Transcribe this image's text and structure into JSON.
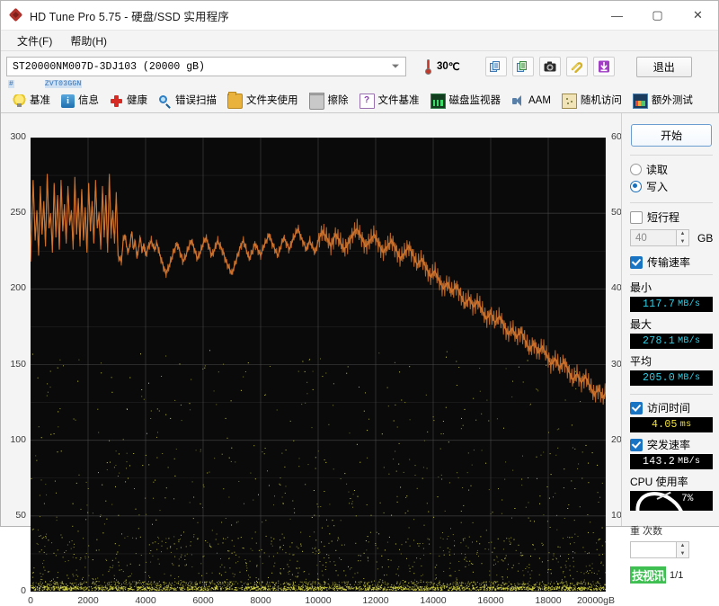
{
  "window": {
    "title": "HD Tune Pro 5.75 - 硬盘/SSD 实用程序",
    "app_icon": "diamond-logo-icon",
    "minimize": "—",
    "maximize": "▢",
    "close": "✕"
  },
  "menu": {
    "items": [
      {
        "label": "文件(F)",
        "name": "menu-file"
      },
      {
        "label": "帮助(H)",
        "name": "menu-help"
      }
    ]
  },
  "drive": {
    "selected": "ST20000NM007D-3DJ103  (20000  gB)",
    "serial_hash": "#",
    "serial": "ZVT03GGN"
  },
  "toolbar": {
    "temperature": "30",
    "temperature_unit": "℃",
    "thermometer_icon": "thermometer-icon",
    "buttons": [
      {
        "name": "copy-button",
        "icon": "copy-icon"
      },
      {
        "name": "copy-alt-button",
        "icon": "copy-green-icon"
      },
      {
        "name": "screenshot-button",
        "icon": "camera-icon"
      },
      {
        "name": "attach-button",
        "icon": "paperclip-icon"
      },
      {
        "name": "download-button",
        "icon": "download-arrow-icon"
      }
    ],
    "exit_label": "退出"
  },
  "tabs": [
    {
      "label": "基准",
      "icon": "bulb-icon",
      "name": "tab-benchmark",
      "active": true
    },
    {
      "label": "信息",
      "icon": "info-icon",
      "name": "tab-info",
      "active": false
    },
    {
      "label": "健康",
      "icon": "health-cross-icon",
      "name": "tab-health",
      "active": false
    },
    {
      "label": "错误扫描",
      "icon": "magnifier-icon",
      "name": "tab-error-scan",
      "active": false
    },
    {
      "label": "文件夹使用",
      "icon": "folder-icon",
      "name": "tab-folder-usage",
      "active": false
    },
    {
      "label": "擦除",
      "icon": "trash-icon",
      "name": "tab-erase",
      "active": false
    },
    {
      "label": "文件基准",
      "icon": "file-bench-icon",
      "name": "tab-file-benchmark",
      "active": false
    },
    {
      "label": "磁盘监视器",
      "icon": "monitor-icon",
      "name": "tab-disk-monitor",
      "active": false
    },
    {
      "label": "AAM",
      "icon": "speaker-icon",
      "name": "tab-aam",
      "active": false
    },
    {
      "label": "随机访问",
      "icon": "random-icon",
      "name": "tab-random-access",
      "active": false
    },
    {
      "label": "额外测试",
      "icon": "extra-icon",
      "name": "tab-extra-tests",
      "active": false
    }
  ],
  "panel": {
    "start_label": "开始",
    "mode": {
      "read_label": "读取",
      "write_label": "写入",
      "selected": "write"
    },
    "short_stroke": {
      "label": "短行程",
      "checked": false,
      "value": "40",
      "unit": "GB"
    },
    "transfer_rate": {
      "label": "传输速率",
      "checked": true,
      "min_label": "最小",
      "min_value": "117.7",
      "max_label": "最大",
      "max_value": "278.1",
      "avg_label": "平均",
      "avg_value": "205.0",
      "unit": "MB/s"
    },
    "access_time": {
      "label": "访问时间",
      "checked": true,
      "value": "4.05",
      "unit": "ms"
    },
    "burst_rate": {
      "label": "突发速率",
      "checked": true,
      "value": "143.2",
      "unit": "MB/s"
    },
    "cpu_usage": {
      "label": "CPU 使用率",
      "value": "7%"
    },
    "extra_label": "重  次数",
    "extra_value": "",
    "watermark_text": "技视讯",
    "page_indicator": "1/1"
  },
  "chart_data": {
    "type": "line",
    "title": "",
    "xlabel": "",
    "ylabel": "MB/s",
    "y2label": "ms",
    "xunit": "gB",
    "xlim": [
      0,
      20000
    ],
    "ylim": [
      0,
      300
    ],
    "y2lim": [
      0,
      60
    ],
    "yticks": [
      0,
      50,
      100,
      150,
      200,
      250,
      300
    ],
    "y2ticks": [
      10,
      20,
      30,
      40,
      50,
      60
    ],
    "xticks": [
      0,
      2000,
      4000,
      6000,
      8000,
      10000,
      12000,
      14000,
      16000,
      18000,
      20000
    ],
    "grid": true,
    "background": "#0a0a0a",
    "gridcolor": "#5a5a5a",
    "series": [
      {
        "name": "传输速率",
        "color": "#d4752e",
        "axis": "left",
        "unit": "MB/s",
        "x": [
          0,
          90,
          160,
          220,
          280,
          340,
          400,
          460,
          520,
          580,
          640,
          700,
          760,
          820,
          880,
          940,
          1000,
          1060,
          1120,
          1180,
          1240,
          1300,
          1360,
          1420,
          1480,
          1540,
          1600,
          1660,
          1720,
          1780,
          1840,
          1900,
          1960,
          2020,
          2080,
          2140,
          2200,
          2260,
          2320,
          2380,
          2440,
          2500,
          2560,
          2620,
          2680,
          2740,
          2800,
          2860,
          2920,
          2980,
          3040,
          3100,
          3160,
          3220,
          3280,
          3340,
          3400,
          3460,
          3520,
          3580,
          3640,
          3700,
          3760,
          3820,
          3880,
          3940,
          4000,
          4100,
          4200,
          4300,
          4400,
          4500,
          4600,
          4700,
          4800,
          4900,
          5000,
          5100,
          5200,
          5300,
          5400,
          5500,
          5600,
          5700,
          5800,
          5900,
          6000,
          6100,
          6200,
          6300,
          6400,
          6500,
          6600,
          6700,
          6800,
          6900,
          7000,
          7100,
          7200,
          7300,
          7400,
          7500,
          7600,
          7700,
          7800,
          7900,
          8000,
          8100,
          8200,
          8300,
          8400,
          8500,
          8600,
          8700,
          8800,
          8900,
          9000,
          9100,
          9200,
          9300,
          9400,
          9500,
          9600,
          9700,
          9800,
          9900,
          10000,
          10150,
          10300,
          10450,
          10600,
          10750,
          10900,
          11050,
          11200,
          11350,
          11500,
          11650,
          11800,
          11950,
          12100,
          12250,
          12400,
          12550,
          12700,
          12850,
          13000,
          13150,
          13300,
          13450,
          13600,
          13750,
          13900,
          14050,
          14200,
          14350,
          14500,
          14650,
          14800,
          14950,
          15100,
          15250,
          15400,
          15550,
          15700,
          15850,
          16000,
          16150,
          16300,
          16450,
          16600,
          16750,
          16900,
          17050,
          17200,
          17350,
          17500,
          17650,
          17800,
          17950,
          18100,
          18250,
          18400,
          18550,
          18700,
          18850,
          19000,
          19150,
          19300,
          19450,
          19600,
          19750,
          19900,
          20000
        ],
        "y": [
          218,
          272,
          232,
          252,
          222,
          268,
          236,
          258,
          228,
          276,
          240,
          250,
          224,
          270,
          234,
          262,
          226,
          272,
          238,
          256,
          230,
          268,
          242,
          252,
          226,
          274,
          236,
          260,
          228,
          266,
          232,
          254,
          224,
          270,
          238,
          258,
          230,
          272,
          240,
          250,
          226,
          268,
          234,
          262,
          224,
          276,
          236,
          252,
          230,
          264,
          222,
          220,
          218,
          232,
          236,
          228,
          224,
          230,
          238,
          226,
          232,
          220,
          228,
          234,
          224,
          230,
          222,
          228,
          232,
          226,
          230,
          222,
          216,
          210,
          214,
          220,
          226,
          230,
          224,
          218,
          222,
          228,
          232,
          226,
          220,
          224,
          230,
          234,
          228,
          222,
          226,
          232,
          228,
          224,
          218,
          214,
          210,
          216,
          222,
          228,
          232,
          226,
          220,
          224,
          230,
          226,
          222,
          228,
          232,
          236,
          230,
          226,
          222,
          228,
          234,
          230,
          226,
          232,
          236,
          240,
          234,
          230,
          226,
          232,
          228,
          224,
          232,
          238,
          234,
          228,
          236,
          232,
          226,
          230,
          236,
          240,
          234,
          228,
          232,
          236,
          230,
          224,
          228,
          232,
          226,
          220,
          224,
          228,
          222,
          216,
          220,
          214,
          208,
          212,
          206,
          200,
          204,
          198,
          202,
          196,
          190,
          194,
          188,
          192,
          186,
          180,
          184,
          178,
          182,
          176,
          170,
          174,
          168,
          172,
          166,
          160,
          164,
          158,
          162,
          156,
          150,
          154,
          148,
          152,
          146,
          140,
          144,
          138,
          142,
          136,
          130,
          134,
          128,
          132,
          126,
          120,
          124,
          118,
          122
        ]
      },
      {
        "name": "访问时间",
        "color": "#d8d84a",
        "axis": "right",
        "unit": "ms",
        "note": "scatter cloud, dense near bottom (0-5 ms), sparse outliers up to ~32 ms",
        "mean": 4.05
      }
    ]
  }
}
